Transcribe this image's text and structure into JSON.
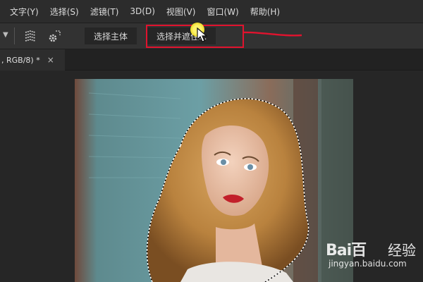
{
  "menu": {
    "items": [
      "文字(Y)",
      "选择(S)",
      "滤镜(T)",
      "3D(D)",
      "视图(V)",
      "窗口(W)",
      "帮助(H)"
    ]
  },
  "options_bar": {
    "select_subject_label": "选择主体",
    "select_and_mask_label": "选择并遮住..."
  },
  "document_tab": {
    "label": ", RGB/8) *",
    "close_glyph": "×"
  },
  "watermark": {
    "logo_text": "Bai百",
    "sub_text": "经验",
    "url": "jingyan.baidu.com"
  },
  "icons": {
    "subtract-icon": "layered-select",
    "gear-icon": "settings",
    "chevron-down-icon": "chevron-down"
  },
  "colors": {
    "annotation_red": "#e0132e",
    "cursor_highlight": "#f2e23a"
  }
}
